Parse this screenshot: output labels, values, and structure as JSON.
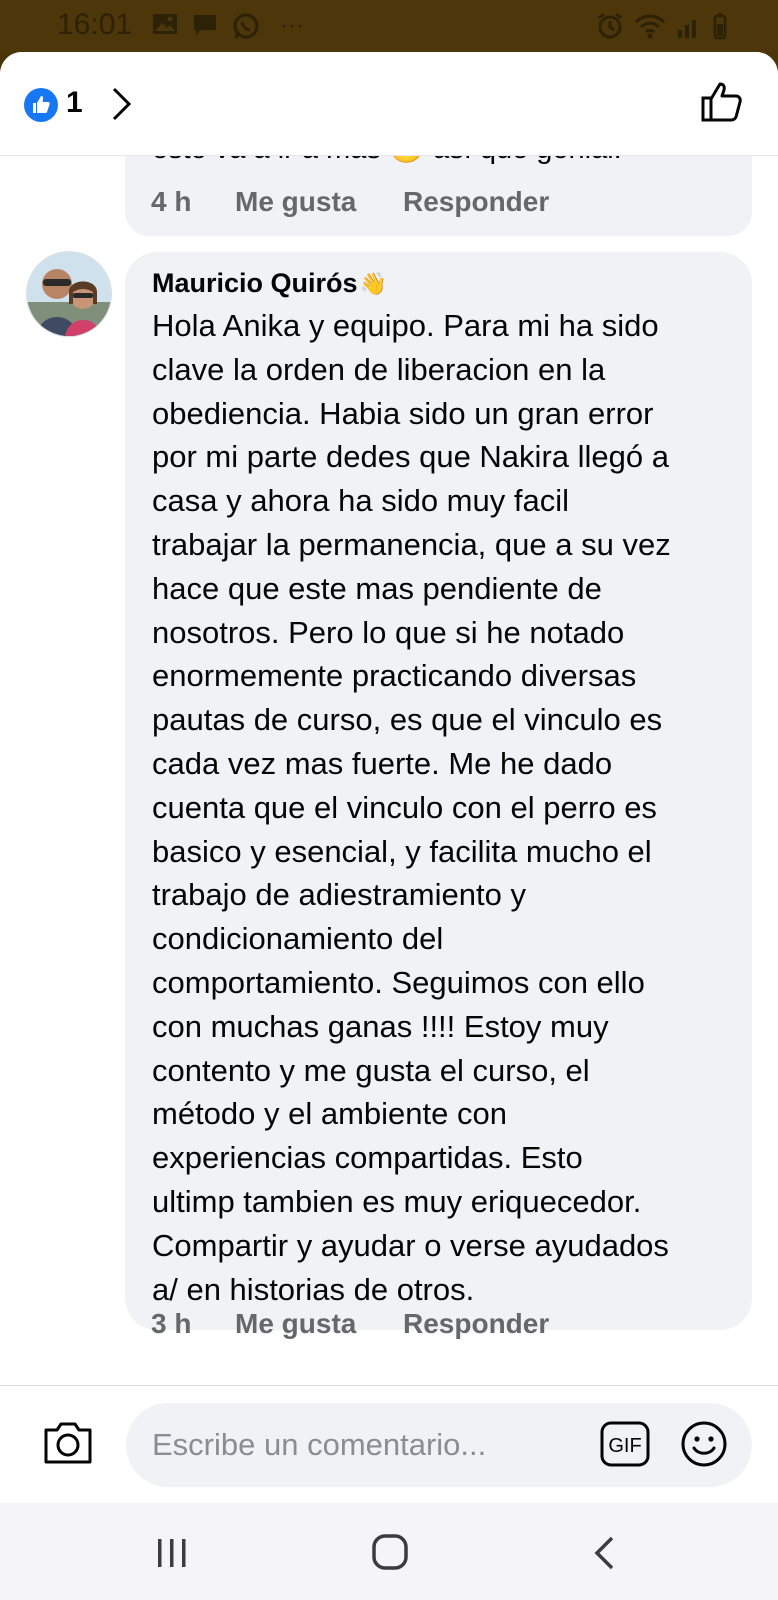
{
  "status_bar": {
    "time": "16:01",
    "more": "···"
  },
  "header": {
    "reaction_count": "1"
  },
  "previous_comment": {
    "partial_text": "esto va a ir a más 😊 así que genial.",
    "actions": {
      "time": "4 h",
      "like": "Me gusta",
      "reply": "Responder"
    }
  },
  "comment": {
    "author": "Mauricio Quirós",
    "author_badge": "👋",
    "lines": [
      "Hola Anika y equipo. Para mi ha sido",
      "clave la orden de liberacion en la",
      "obediencia. Habia sido un gran error",
      "por mi parte dedes que Nakira llegó a",
      "casa y ahora ha sido muy facil",
      "trabajar la permanencia, que a su vez",
      "hace que este mas pendiente de",
      "nosotros. Pero lo que si he notado",
      "enormemente practicando diversas",
      "pautas de curso, es que el vinculo es",
      "cada vez mas fuerte. Me he dado",
      "cuenta que el vinculo con el perro es",
      "basico y esencial, y facilita mucho el",
      "trabajo de adiestramiento y",
      "condicionamiento del",
      "comportamiento. Seguimos con ello",
      "con muchas ganas !!!! Estoy muy",
      "contento y me gusta el curso, el",
      "método y el ambiente con",
      "experiencias compartidas. Esto",
      "ultimp tambien es muy eriquecedor.",
      "Compartir y ayudar o verse ayudados",
      "a/ en historias de otros."
    ],
    "actions": {
      "time": "3 h",
      "like": "Me gusta",
      "reply": "Responder"
    }
  },
  "composer": {
    "placeholder": "Escribe un comentario...",
    "gif_label": "GIF"
  },
  "colors": {
    "accent": "#1877f2",
    "bubble": "#f0f2f5",
    "meta_text": "#65676b",
    "status_bar": "#4d3609"
  }
}
